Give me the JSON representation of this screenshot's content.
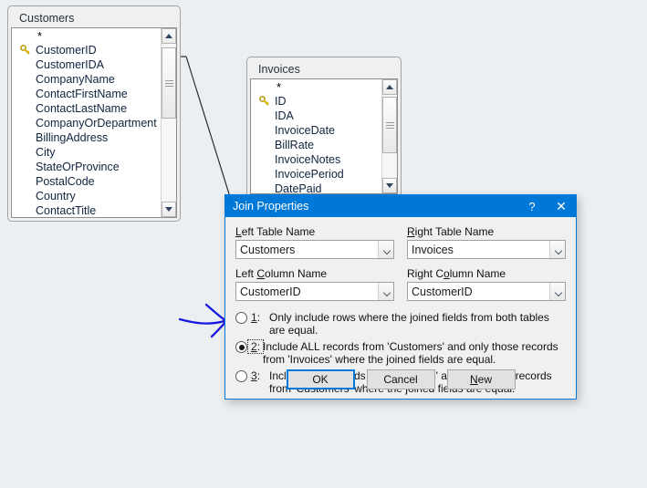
{
  "background_color": "#eceff1",
  "accent_color": "#0078d7",
  "annotation_color": "#1818e0",
  "design_surface": {
    "name": "query-design-surface",
    "tables": [
      {
        "title": "Customers",
        "fields": [
          {
            "name": "*",
            "key": false
          },
          {
            "name": "CustomerID",
            "key": true
          },
          {
            "name": "CustomerIDA",
            "key": false
          },
          {
            "name": "CompanyName",
            "key": false
          },
          {
            "name": "ContactFirstName",
            "key": false
          },
          {
            "name": "ContactLastName",
            "key": false
          },
          {
            "name": "CompanyOrDepartment",
            "key": false
          },
          {
            "name": "BillingAddress",
            "key": false
          },
          {
            "name": "City",
            "key": false
          },
          {
            "name": "StateOrProvince",
            "key": false
          },
          {
            "name": "PostalCode",
            "key": false
          },
          {
            "name": "Country",
            "key": false
          },
          {
            "name": "ContactTitle",
            "key": false
          }
        ]
      },
      {
        "title": "Invoices",
        "fields": [
          {
            "name": "*",
            "key": false
          },
          {
            "name": "ID",
            "key": true
          },
          {
            "name": "IDA",
            "key": false
          },
          {
            "name": "InvoiceDate",
            "key": false
          },
          {
            "name": "BillRate",
            "key": false
          },
          {
            "name": "InvoiceNotes",
            "key": false
          },
          {
            "name": "InvoicePeriod",
            "key": false
          },
          {
            "name": "DatePaid",
            "key": false
          }
        ]
      }
    ]
  },
  "dialog": {
    "title": "Join Properties",
    "help_label": "?",
    "close_label": "✕",
    "left_table": {
      "label_pre": "",
      "label_accel": "L",
      "label_post": "eft Table Name",
      "value": "Customers"
    },
    "right_table": {
      "label_pre": "",
      "label_accel": "R",
      "label_post": "ight Table Name",
      "value": "Invoices"
    },
    "left_column": {
      "label_pre": "Left ",
      "label_accel": "C",
      "label_post": "olumn Name",
      "value": "CustomerID"
    },
    "right_column": {
      "label_pre": "Right C",
      "label_accel": "o",
      "label_post": "lumn Name",
      "value": "CustomerID"
    },
    "options": [
      {
        "num_pre": "",
        "num_accel": "1",
        "num_post": ":",
        "text": "Only include rows where the joined fields from both tables are equal.",
        "selected": false,
        "focused": false
      },
      {
        "num_pre": "",
        "num_accel": "2",
        "num_post": ":",
        "text": "Include ALL records from 'Customers' and only those records from 'Invoices' where the joined fields are equal.",
        "selected": true,
        "focused": true
      },
      {
        "num_pre": "",
        "num_accel": "3",
        "num_post": ":",
        "text": "Include ALL records from 'Invoices' and only those records from 'Customers' where the joined fields are equal.",
        "selected": false,
        "focused": false
      }
    ],
    "buttons": [
      {
        "label_pre": "OK",
        "label_accel": "",
        "label_post": "",
        "default": true
      },
      {
        "label_pre": "Cancel",
        "label_accel": "",
        "label_post": "",
        "default": false
      },
      {
        "label_pre": "",
        "label_accel": "N",
        "label_post": "ew",
        "default": false
      }
    ]
  }
}
